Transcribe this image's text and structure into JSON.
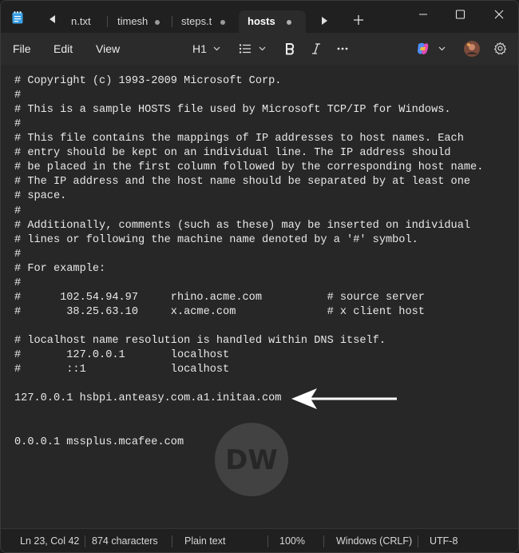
{
  "tabs": [
    {
      "label": "n.txt",
      "modified": false,
      "active": false
    },
    {
      "label": "timesh",
      "modified": true,
      "active": false
    },
    {
      "label": "steps.t",
      "modified": true,
      "active": false
    },
    {
      "label": "hosts",
      "modified": true,
      "active": true
    }
  ],
  "menu": {
    "file": "File",
    "edit": "Edit",
    "view": "View"
  },
  "toolbar": {
    "heading": "H1"
  },
  "editor_lines": [
    "# Copyright (c) 1993-2009 Microsoft Corp.",
    "#",
    "# This is a sample HOSTS file used by Microsoft TCP/IP for Windows.",
    "#",
    "# This file contains the mappings of IP addresses to host names. Each",
    "# entry should be kept on an individual line. The IP address should",
    "# be placed in the first column followed by the corresponding host name.",
    "# The IP address and the host name should be separated by at least one",
    "# space.",
    "#",
    "# Additionally, comments (such as these) may be inserted on individual",
    "# lines or following the machine name denoted by a '#' symbol.",
    "#",
    "# For example:",
    "#",
    "#      102.54.94.97     rhino.acme.com          # source server",
    "#       38.25.63.10     x.acme.com              # x client host",
    "",
    "# localhost name resolution is handled within DNS itself.",
    "#       127.0.0.1       localhost",
    "#       ::1             localhost",
    "",
    "127.0.0.1 hsbpi.anteasy.com.a1.initaa.com",
    "",
    "",
    "0.0.0.1 mssplus.mcafee.com"
  ],
  "status": {
    "position": "Ln 23, Col 42",
    "characters": "874 characters",
    "format": "Plain text",
    "zoom": "100%",
    "line_ending": "Windows (CRLF)",
    "encoding": "UTF-8"
  },
  "icons": {
    "app": "notepad-icon",
    "copilot": "copilot-icon",
    "account": "avatar",
    "settings": "gear-icon"
  },
  "colors": {
    "background": "#272727",
    "titlebar": "#202020",
    "menubar": "#2b2b2b",
    "text": "#e8e8e8",
    "app_icon": "#3aa0e6"
  }
}
